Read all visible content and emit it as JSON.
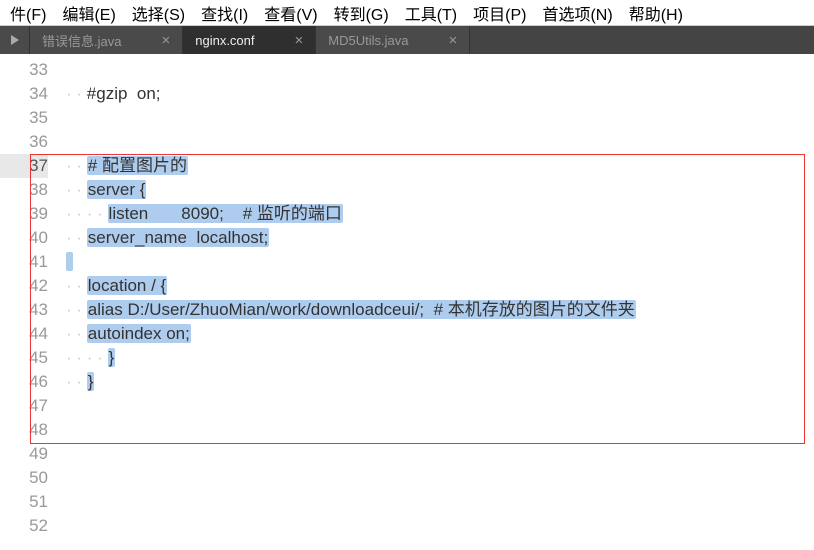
{
  "menu": {
    "items": [
      "件(F)",
      "编辑(E)",
      "选择(S)",
      "查找(I)",
      "查看(V)",
      "转到(G)",
      "工具(T)",
      "项目(P)",
      "首选项(N)",
      "帮助(H)"
    ]
  },
  "tabs": [
    {
      "label": "错误信息.java",
      "active": false
    },
    {
      "label": "nginx.conf",
      "active": true
    },
    {
      "label": "MD5Utils.java",
      "active": false
    }
  ],
  "lines": [
    {
      "num": "33",
      "text": ""
    },
    {
      "num": "34",
      "text": "    #gzip  on;"
    },
    {
      "num": "35",
      "text": ""
    },
    {
      "num": "36",
      "text": ""
    },
    {
      "num": "37",
      "text": "    # 配置图片的",
      "sel": true,
      "current": true
    },
    {
      "num": "38",
      "text": "    server {",
      "sel": true
    },
    {
      "num": "39",
      "text": "        listen       8090;    # 监听的端口",
      "sel": true
    },
    {
      "num": "40",
      "text": "    server_name  localhost;",
      "sel": true
    },
    {
      "num": "41",
      "text": "",
      "sel": true
    },
    {
      "num": "42",
      "text": "    location / {",
      "sel": true
    },
    {
      "num": "43",
      "text": "    alias D:/User/ZhuoMian/work/downloadceui/;  # 本机存放的图片的文件夹",
      "sel": true
    },
    {
      "num": "44",
      "text": "    autoindex on;",
      "sel": true
    },
    {
      "num": "45",
      "text": "        }",
      "sel": true
    },
    {
      "num": "46",
      "text": "    }",
      "sel": true
    },
    {
      "num": "47",
      "text": ""
    },
    {
      "num": "48",
      "text": ""
    },
    {
      "num": "49",
      "text": ""
    },
    {
      "num": "50",
      "text": ""
    },
    {
      "num": "51",
      "text": ""
    },
    {
      "num": "52",
      "text": ""
    }
  ]
}
